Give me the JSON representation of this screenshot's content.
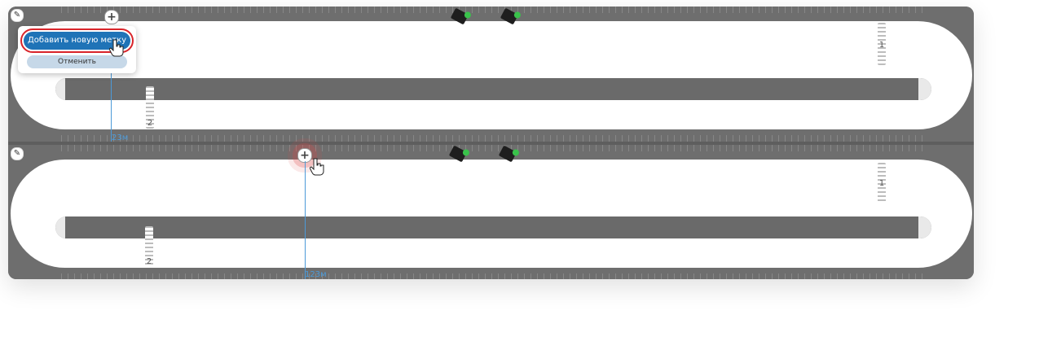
{
  "popup": {
    "primary_button": "Добавить новую метку",
    "secondary_button": "Отменить"
  },
  "panels": [
    {
      "id": "top",
      "measure_label": "23м",
      "pin_labels": [
        "1",
        "2"
      ]
    },
    {
      "id": "bottom",
      "measure_label": "123м",
      "pin_labels": [
        "1",
        "2"
      ]
    }
  ],
  "icons": {
    "edit": "pencil-icon",
    "add": "plus-icon",
    "vehicle": "vehicle-icon",
    "cursor": "hand-pointer-icon"
  },
  "colors": {
    "accent": "#1f73b7",
    "focus_ring": "#d9242a",
    "measure_line": "#4c9ad8",
    "status_dot": "#39c24b"
  }
}
